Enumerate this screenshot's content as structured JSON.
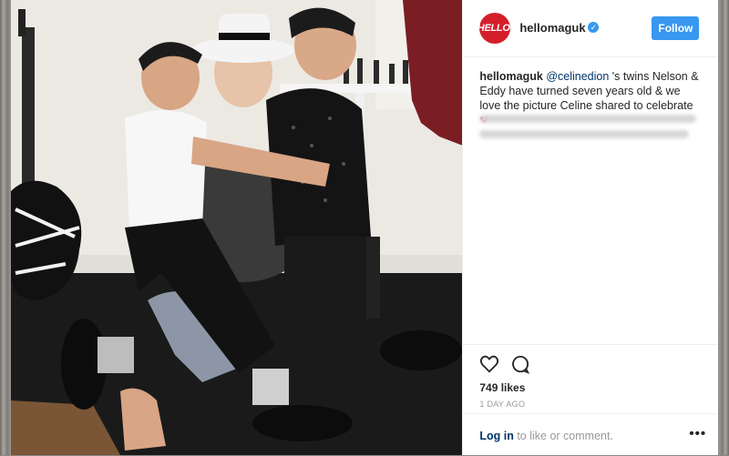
{
  "post": {
    "username": "hellomaguk",
    "avatar_text": "HELLO!",
    "follow_label": "Follow",
    "caption_user": "hellomaguk",
    "caption_mention": "@celinedion",
    "caption_text": " 's twins Nelson & Eddy have turned seven years old & we love the picture Celine shared to celebrate ",
    "caption_emoji": "❤",
    "likes": "749 likes",
    "time": "1 DAY AGO",
    "login_link": "Log in",
    "login_text": " to like or comment.",
    "more": "•••"
  },
  "colors": {
    "brand": "#d41f2b",
    "accent": "#3897f0",
    "link": "#003569"
  },
  "icons": [
    "heart-icon",
    "comment-icon",
    "verified-icon",
    "more-options-icon"
  ]
}
